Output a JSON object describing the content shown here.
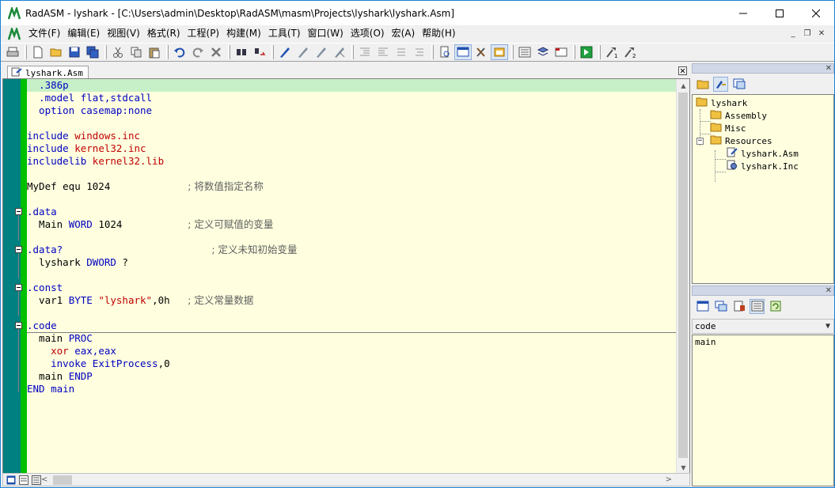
{
  "title": "RadASM - lyshark - [C:\\Users\\admin\\Desktop\\RadASM\\masm\\Projects\\lyshark\\lyshark.Asm]",
  "window_controls": {
    "minimize": "—",
    "maximize": "☐",
    "close": "✕"
  },
  "menu": [
    "文件(F)",
    "编辑(E)",
    "视图(V)",
    "格式(R)",
    "工程(P)",
    "构建(M)",
    "工具(T)",
    "窗口(W)",
    "选项(O)",
    "宏(A)",
    "帮助(H)"
  ],
  "mdi_controls": {
    "minimize": "_",
    "restore": "❐",
    "close": "✕"
  },
  "editor": {
    "tab_label": "lyshark.Asm",
    "lines": [
      [
        {
          "t": "  .386p",
          "c": "kw"
        }
      ],
      [
        {
          "t": "  .model flat,stdcall",
          "c": "kw"
        }
      ],
      [
        {
          "t": "  option casemap:none",
          "c": "kw"
        }
      ],
      [],
      [
        {
          "t": "include ",
          "c": "kw"
        },
        {
          "t": "windows.inc",
          "c": "str"
        }
      ],
      [
        {
          "t": "include ",
          "c": "kw"
        },
        {
          "t": "kernel32.inc",
          "c": "str"
        }
      ],
      [
        {
          "t": "includelib ",
          "c": "kw"
        },
        {
          "t": "kernel32.lib",
          "c": "str"
        }
      ],
      [],
      [
        {
          "t": "MyDef equ 1024",
          "c": "txt"
        },
        {
          "t": "             ",
          "c": "txt"
        },
        {
          "t": "; 将数值指定名称",
          "c": "cmt"
        }
      ],
      [],
      [
        {
          "t": ".data",
          "c": "kw"
        }
      ],
      [
        {
          "t": "  Main ",
          "c": "txt"
        },
        {
          "t": "WORD",
          "c": "kw"
        },
        {
          "t": " 1024",
          "c": "txt"
        },
        {
          "t": "           ",
          "c": "txt"
        },
        {
          "t": "; 定义可赋值的变量",
          "c": "cmt"
        }
      ],
      [],
      [
        {
          "t": ".data?",
          "c": "kw"
        },
        {
          "t": "                         ",
          "c": "txt"
        },
        {
          "t": "; 定义未知初始变量",
          "c": "cmt"
        }
      ],
      [
        {
          "t": "  lyshark ",
          "c": "txt"
        },
        {
          "t": "DWORD",
          "c": "kw"
        },
        {
          "t": " ?",
          "c": "txt"
        }
      ],
      [],
      [
        {
          "t": ".const",
          "c": "kw"
        }
      ],
      [
        {
          "t": "  var1 ",
          "c": "txt"
        },
        {
          "t": "BYTE",
          "c": "kw"
        },
        {
          "t": " ",
          "c": "txt"
        },
        {
          "t": "\"lyshark\"",
          "c": "str"
        },
        {
          "t": ",0h",
          "c": "txt"
        },
        {
          "t": "   ",
          "c": "txt"
        },
        {
          "t": "; 定义常量数据",
          "c": "cmt"
        }
      ],
      [],
      [
        {
          "t": ".code",
          "c": "kw"
        }
      ],
      [
        {
          "t": "  main ",
          "c": "txt"
        },
        {
          "t": "PROC",
          "c": "kw"
        }
      ],
      [
        {
          "t": "    ",
          "c": "txt"
        },
        {
          "t": "xor",
          "c": "str"
        },
        {
          "t": " eax,eax",
          "c": "kw"
        }
      ],
      [
        {
          "t": "    invoke ",
          "c": "kw"
        },
        {
          "t": "ExitProcess",
          "c": "kw"
        },
        {
          "t": ",0",
          "c": "txt"
        }
      ],
      [
        {
          "t": "  main ",
          "c": "txt"
        },
        {
          "t": "ENDP",
          "c": "kw"
        }
      ],
      [
        {
          "t": "END main",
          "c": "kw"
        }
      ]
    ]
  },
  "project": {
    "root": "lyshark",
    "folders": [
      "Assembly",
      "Misc",
      "Resources"
    ],
    "files": [
      "lyshark.Asm",
      "lyshark.Inc"
    ]
  },
  "properties": {
    "combo_value": "code",
    "items": [
      "main"
    ]
  },
  "colors": {
    "accent": "#1883d7",
    "editor_bg": "#ffffe0",
    "gutter": "#008080",
    "fold": "#00c000",
    "current_line": "#c8f0c8",
    "keyword": "#0000c0",
    "string": "#c00000"
  }
}
